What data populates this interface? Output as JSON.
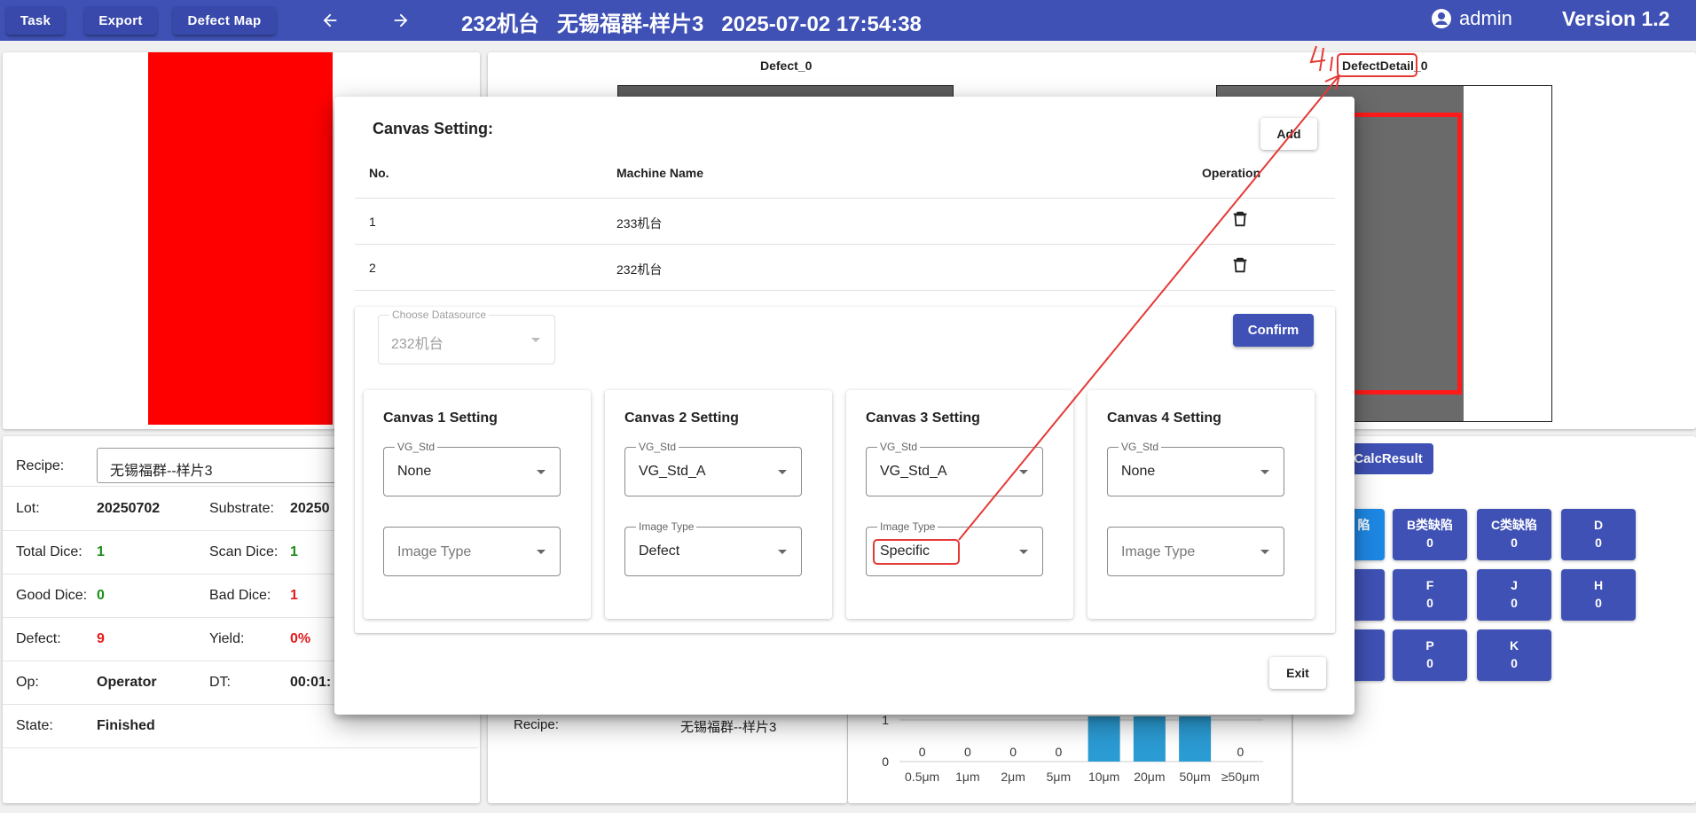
{
  "topbar": {
    "task_label": "Task",
    "export_label": "Export",
    "defect_map_label": "Defect Map",
    "title": "232机台   无锡福群-样片3   2025-07-02 17:54:38",
    "user": "admin",
    "version": "Version 1.2"
  },
  "defect_panel": {
    "defect_title": "Defect_0",
    "defect_detail_title": "DefectDetail_0"
  },
  "info": {
    "recipe_label": "Recipe:",
    "recipe_value": "无锡福群--样片3",
    "lot_label": "Lot:",
    "lot_value": "20250702",
    "substrate_label": "Substrate:",
    "substrate_value": "20250",
    "total_dice_label": "Total Dice:",
    "total_dice_value": "1",
    "scan_dice_label": "Scan Dice:",
    "scan_dice_value": "1",
    "good_dice_label": "Good Dice:",
    "good_dice_value": "0",
    "bad_dice_label": "Bad Dice:",
    "bad_dice_value": "1",
    "defect_label": "Defect:",
    "defect_value": "9",
    "yield_label": "Yield:",
    "yield_value": "0%",
    "op_label": "Op:",
    "op_value": "Operator",
    "dt_label": "DT:",
    "dt_value": "00:01:",
    "state_label": "State:",
    "state_value": "Finished"
  },
  "summary": {
    "recipe_label": "Recipe:",
    "recipe_value": "无锡福群--样片3"
  },
  "calc_result_label": "CalcResult",
  "defect_buttons": [
    {
      "name": "陷",
      "count": "",
      "style": "blue"
    },
    {
      "name": "B类缺陷",
      "count": "0"
    },
    {
      "name": "C类缺陷",
      "count": "0"
    },
    {
      "name": "D",
      "count": "0"
    },
    {
      "name": "",
      "count": ""
    },
    {
      "name": "F",
      "count": "0"
    },
    {
      "name": "J",
      "count": "0"
    },
    {
      "name": "H",
      "count": "0"
    },
    {
      "name": "",
      "count": ""
    },
    {
      "name": "P",
      "count": "0"
    },
    {
      "name": "K",
      "count": "0"
    }
  ],
  "chart_data": {
    "type": "bar",
    "categories": [
      "0.5μm",
      "1μm",
      "2μm",
      "5μm",
      "10μm",
      "20μm",
      "50μm",
      "≥50μm"
    ],
    "values": [
      0,
      0,
      0,
      0,
      1,
      1,
      1,
      0
    ],
    "value_labels": [
      "0",
      "0",
      "0",
      "0",
      "",
      "",
      "",
      "0"
    ],
    "y_ticks": [
      "0",
      "1"
    ],
    "bar_color": "#2b9bd3"
  },
  "modal": {
    "title": "Canvas Setting:",
    "add_label": "Add",
    "col_no": "No.",
    "col_machine": "Machine Name",
    "col_operation": "Operation",
    "rows": [
      {
        "no": "1",
        "machine": "233机台"
      },
      {
        "no": "2",
        "machine": "232机台"
      }
    ],
    "datasource_label": "Choose Datasource",
    "datasource_value": "232机台",
    "confirm_label": "Confirm",
    "exit_label": "Exit",
    "cards": [
      {
        "title": "Canvas 1 Setting",
        "vg_label": "VG_Std",
        "vg_value": "None",
        "img_label": "",
        "img_value": "Image Type"
      },
      {
        "title": "Canvas 2 Setting",
        "vg_label": "VG_Std",
        "vg_value": "VG_Std_A",
        "img_label": "Image Type",
        "img_value": "Defect"
      },
      {
        "title": "Canvas 3 Setting",
        "vg_label": "VG_Std",
        "vg_value": "VG_Std_A",
        "img_label": "Image Type",
        "img_value": "Specific"
      },
      {
        "title": "Canvas 4 Setting",
        "vg_label": "VG_Std",
        "vg_value": "None",
        "img_label": "",
        "img_value": "Image Type"
      }
    ]
  },
  "colors": {
    "primary": "#3f51b5",
    "annotation": "#e53935"
  }
}
